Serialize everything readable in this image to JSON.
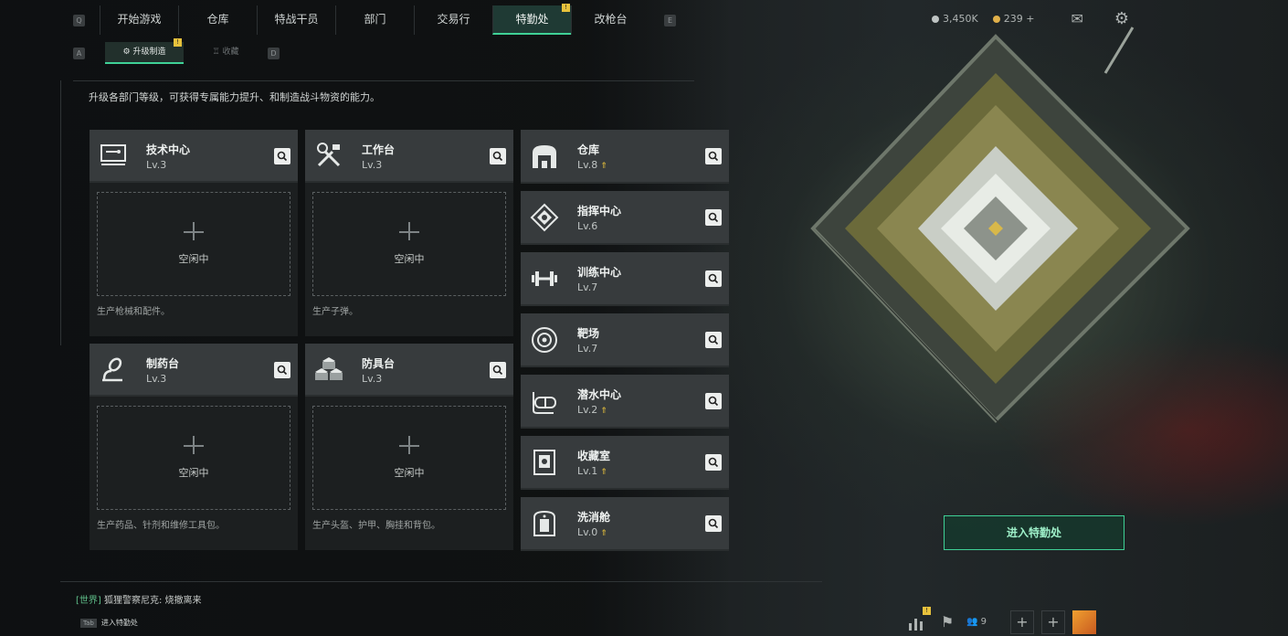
{
  "nav": {
    "left_key": "Q",
    "right_key": "E",
    "tabs": [
      {
        "label": "开始游戏"
      },
      {
        "label": "仓库"
      },
      {
        "label": "特战干员"
      },
      {
        "label": "部门"
      },
      {
        "label": "交易行"
      },
      {
        "label": "特勤处",
        "badge": "!"
      },
      {
        "label": "改枪台"
      }
    ],
    "active_tab": "特勤处"
  },
  "subnav": {
    "left_key": "A",
    "right_key": "D",
    "tabs": [
      {
        "label": "升级制造",
        "badge": "!"
      },
      {
        "label": "收藏"
      }
    ]
  },
  "currency": {
    "coins": "3,450K",
    "tickets": "239",
    "add": "+"
  },
  "description": "升级各部门等级，可获得专属能力提升、和制造战斗物资的能力。",
  "crafting": [
    {
      "name": "技术中心",
      "level": "Lv.3",
      "slot_status": "空闲中",
      "note": "生产枪械和配件。",
      "icon": "tech-center-icon"
    },
    {
      "name": "工作台",
      "level": "Lv.3",
      "slot_status": "空闲中",
      "note": "生产子弹。",
      "icon": "workbench-icon"
    },
    {
      "name": "制药台",
      "level": "Lv.3",
      "slot_status": "空闲中",
      "note": "生产药品、针剂和维修工具包。",
      "icon": "pharmacy-icon"
    },
    {
      "name": "防具台",
      "level": "Lv.3",
      "slot_status": "空闲中",
      "note": "生产头盔、护甲、胸挂和背包。",
      "icon": "armor-bench-icon"
    }
  ],
  "facilities": [
    {
      "name": "仓库",
      "level": "Lv.8",
      "upgradable": true,
      "icon": "warehouse-icon"
    },
    {
      "name": "指挥中心",
      "level": "Lv.6",
      "upgradable": false,
      "icon": "command-center-icon"
    },
    {
      "name": "训练中心",
      "level": "Lv.7",
      "upgradable": false,
      "icon": "training-center-icon"
    },
    {
      "name": "靶场",
      "level": "Lv.7",
      "upgradable": false,
      "icon": "shooting-range-icon"
    },
    {
      "name": "潜水中心",
      "level": "Lv.2",
      "upgradable": true,
      "icon": "diving-center-icon"
    },
    {
      "name": "收藏室",
      "level": "Lv.1",
      "upgradable": true,
      "icon": "collection-room-icon"
    },
    {
      "name": "洗消舱",
      "level": "Lv.0",
      "upgradable": true,
      "icon": "decon-chamber-icon"
    }
  ],
  "enter_button": "进入特勤处",
  "chat": {
    "channel": "[世界]",
    "message": "狐狸警察尼克: 烧撤离来"
  },
  "tab_hint": {
    "key": "Tab",
    "label": "进入特勤处"
  },
  "bottom": {
    "friends_count": "9",
    "badge": "!"
  },
  "colors": {
    "accent": "#3fd196",
    "badge": "#e8c23c",
    "card_header": "#373b3d"
  }
}
